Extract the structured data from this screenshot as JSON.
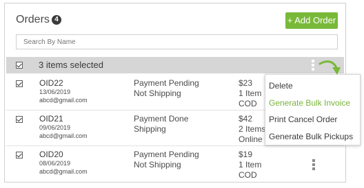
{
  "header": {
    "title": "Orders",
    "count": "4",
    "add_button_label": "+ Add Order"
  },
  "search": {
    "placeholder": "Search By Name"
  },
  "selection": {
    "text": "3 items selected"
  },
  "orders": [
    {
      "id": "OID22",
      "date": "13/06/2019",
      "email": "abcd@gmail.com",
      "payment": "Payment Pending",
      "shipping": "Not Shipping",
      "price": "$23",
      "items": "1 Item",
      "method": "COD"
    },
    {
      "id": "OID21",
      "date": "09/06/2019",
      "email": "abcd@gmail.com",
      "payment": "Payment Done",
      "shipping": "Shipping",
      "price": "$42",
      "items": "2 Items",
      "method": "Online"
    },
    {
      "id": "OID20",
      "date": "08/06/2019",
      "email": "abcd@gmail.com",
      "payment": "Payment Pending",
      "shipping": "Not Shipping",
      "price": "$19",
      "items": "1 Item",
      "method": "COD"
    }
  ],
  "menu": {
    "items": [
      "Delete",
      "Generate Bulk Invoice",
      "Print Cancel Order",
      "Generate Bulk Pickups"
    ],
    "active_index": 1
  },
  "colors": {
    "accent": "#79b939",
    "selection_bar": "#d6d6d6"
  }
}
